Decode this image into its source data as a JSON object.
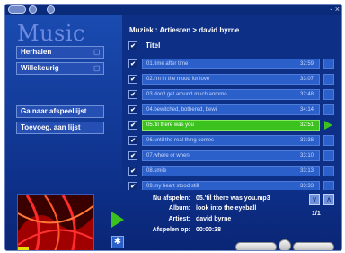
{
  "app": {
    "title": "Music"
  },
  "topbar": {
    "window_controls": "-  ×"
  },
  "sidebar": {
    "buttons": [
      {
        "label": "Herhalen"
      },
      {
        "label": "Willekeurig"
      },
      {
        "label": "Ga naar afspeellijst"
      },
      {
        "label": "Toevoeg. aan lijst"
      }
    ]
  },
  "breadcrumb": "Muziek : Artiesten > david byrne",
  "list": {
    "header_check": "✔",
    "header": "Titel",
    "tracks": [
      {
        "title": "01.time after time",
        "duration": "32:59"
      },
      {
        "title": "02.i'm in the mood for love",
        "duration": "33:07"
      },
      {
        "title": "03.don't get around much anmmo",
        "duration": "32:48"
      },
      {
        "title": "04.bewitched, bothered, bewil",
        "duration": "34:14"
      },
      {
        "title": "05.'til there was you",
        "duration": "32:51"
      },
      {
        "title": "06.until the real thing comes",
        "duration": "33:38"
      },
      {
        "title": "07.where or when",
        "duration": "33:10"
      },
      {
        "title": "08.smile",
        "duration": "33:13"
      },
      {
        "title": "09.my heart stood still",
        "duration": "33:33"
      }
    ],
    "check": "✔"
  },
  "now_playing": {
    "now_label": "Nu afspelen:",
    "now_value": "05.'til there was you.mp3",
    "album_label": "Album:",
    "album_value": "look into the eyeball",
    "artist_label": "Artiest:",
    "artist_value": "david byrne",
    "time_label": "Afspelen op:",
    "time_value": "00:00:38"
  },
  "paging": {
    "page": "1/1",
    "down": "∨",
    "up": "∧"
  },
  "visualizer_btn": "✱"
}
